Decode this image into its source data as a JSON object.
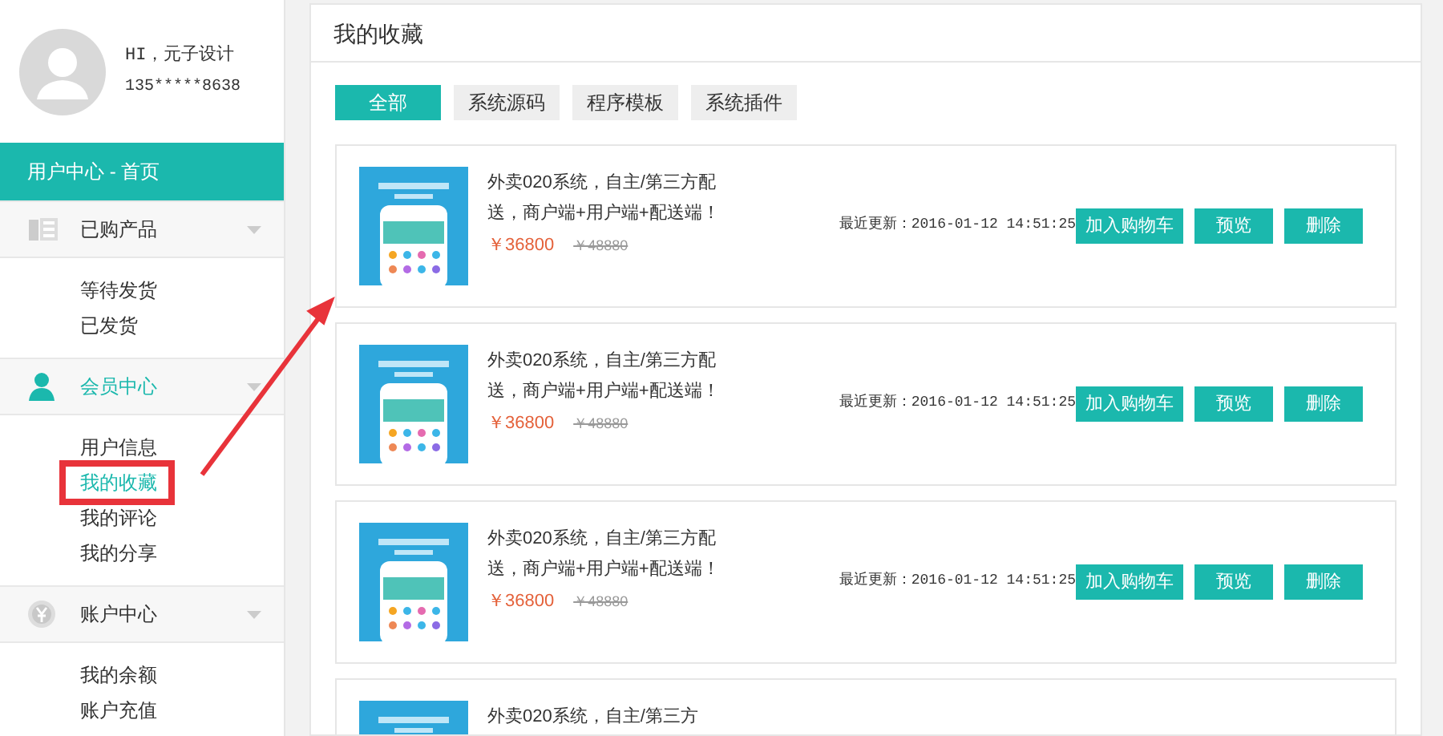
{
  "sidebar": {
    "user": {
      "greeting": "HI，元子设计",
      "phone": "135*****8638"
    },
    "home_link": "用户中心 - 首页",
    "sections": [
      {
        "kind": "products",
        "label": "已购产品",
        "active": false,
        "items": [
          {
            "label": "等待发货",
            "selected": false
          },
          {
            "label": "已发货",
            "selected": false
          }
        ]
      },
      {
        "kind": "member",
        "label": "会员中心",
        "active": true,
        "items": [
          {
            "label": "用户信息",
            "selected": false
          },
          {
            "label": "我的收藏",
            "selected": true
          },
          {
            "label": "我的评论",
            "selected": false
          },
          {
            "label": "我的分享",
            "selected": false
          }
        ]
      },
      {
        "kind": "account",
        "label": "账户中心",
        "active": false,
        "items": [
          {
            "label": "我的余额",
            "selected": false
          },
          {
            "label": "账户充值",
            "selected": false
          }
        ]
      }
    ]
  },
  "main": {
    "title": "我的收藏",
    "tabs": [
      {
        "label": "全部",
        "selected": true
      },
      {
        "label": "系统源码",
        "selected": false
      },
      {
        "label": "程序模板",
        "selected": false
      },
      {
        "label": "系统插件",
        "selected": false
      }
    ],
    "favorites": [
      {
        "description": "外卖020系统，自主/第三方配送，商户端+用户端+配送端！",
        "price": "￥36800",
        "old_price": "￥48880",
        "updated": "最近更新：2016-01-12 14:51:25",
        "buttons": [
          "加入购物车",
          "预览",
          "删除"
        ]
      },
      {
        "description": "外卖020系统，自主/第三方配送，商户端+用户端+配送端！",
        "price": "￥36800",
        "old_price": "￥48880",
        "updated": "最近更新：2016-01-12 14:51:25",
        "buttons": [
          "加入购物车",
          "预览",
          "删除"
        ]
      },
      {
        "description": "外卖020系统，自主/第三方配送，商户端+用户端+配送端！",
        "price": "￥36800",
        "old_price": "￥48880",
        "updated": "最近更新：2016-01-12 14:51:25",
        "buttons": [
          "加入购物车",
          "预览",
          "删除"
        ]
      },
      {
        "description": "外卖020系统，自主/第三方"
      }
    ]
  }
}
